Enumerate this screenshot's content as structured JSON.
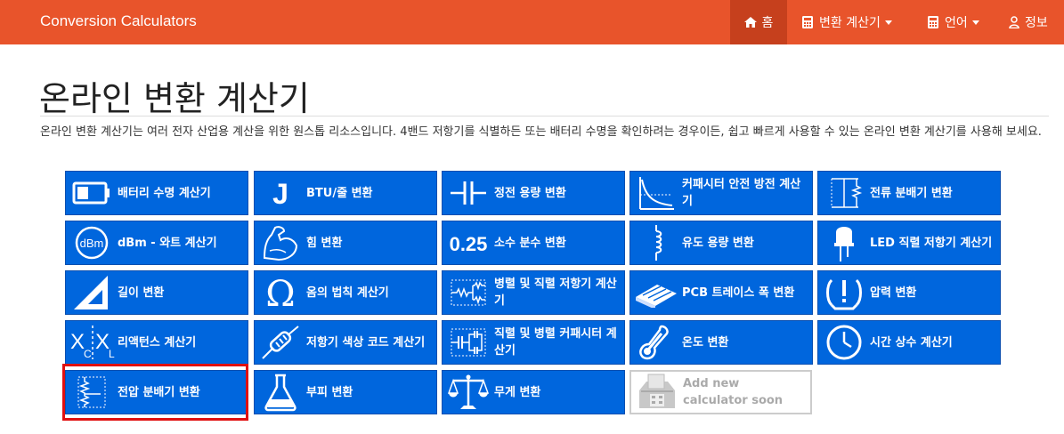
{
  "nav": {
    "brand": "Conversion Calculators",
    "home": "홈",
    "calculators": "변환 계산기",
    "language": "언어",
    "info": "정보"
  },
  "page": {
    "title": "온라인 변환 계산기",
    "intro": "온라인 변환 계산기는 여러 전자 산업용 계산을 위한 원스톱 리소스입니다. 4밴드 저항기를 식별하든 또는 배터리 수명을 확인하려는 경우이든, 쉽고 빠르게 사용할 수 있는 온라인 변환 계산기를 사용해 보세요."
  },
  "tiles": [
    {
      "label": "배터리 수명 계산기",
      "icon": "battery-icon"
    },
    {
      "label": "BTU/줄 변환",
      "icon": "joule-icon"
    },
    {
      "label": "정전 용량 변환",
      "icon": "capacitor-icon"
    },
    {
      "label": "커패시터 안전 방전 계산기",
      "icon": "discharge-curve-icon"
    },
    {
      "label": "전류 분배기 변환",
      "icon": "current-divider-icon"
    },
    {
      "label": "dBm - 와트 계산기",
      "icon": "dbm-icon"
    },
    {
      "label": "힘 변환",
      "icon": "muscle-arm-icon"
    },
    {
      "label": "소수 분수 변환",
      "icon": "decimal-icon"
    },
    {
      "label": "유도 용량 변환",
      "icon": "inductor-icon"
    },
    {
      "label": "LED 직렬 저항기 계산기",
      "icon": "led-icon"
    },
    {
      "label": "길이 변환",
      "icon": "set-square-icon"
    },
    {
      "label": "옴의 법칙 계산기",
      "icon": "omega-icon"
    },
    {
      "label": "병렬 및 직렬 저항기 계산기",
      "icon": "resistor-network-icon"
    },
    {
      "label": "PCB 트레이스 폭 변환",
      "icon": "pcb-icon"
    },
    {
      "label": "압력 변환",
      "icon": "pressure-warning-icon"
    },
    {
      "label": "리액턴스 계산기",
      "icon": "reactance-icon"
    },
    {
      "label": "저항기 색상 코드 계산기",
      "icon": "resistor-icon"
    },
    {
      "label": "직렬 및 병렬 커패시터 계산기",
      "icon": "capacitor-network-icon"
    },
    {
      "label": "온도 변환",
      "icon": "thermometer-icon"
    },
    {
      "label": "시간 상수 계산기",
      "icon": "clock-icon"
    },
    {
      "label": "전압 분배기 변환",
      "icon": "voltage-divider-icon"
    },
    {
      "label": "부피 변환",
      "icon": "flask-icon"
    },
    {
      "label": "무게 변환",
      "icon": "scale-icon"
    },
    {
      "label": "Add new calculator soon",
      "icon": "ballot-box-icon"
    }
  ],
  "colors": {
    "navbar": "#e8542b",
    "tile": "#0066dd",
    "highlight": "#e01010"
  }
}
